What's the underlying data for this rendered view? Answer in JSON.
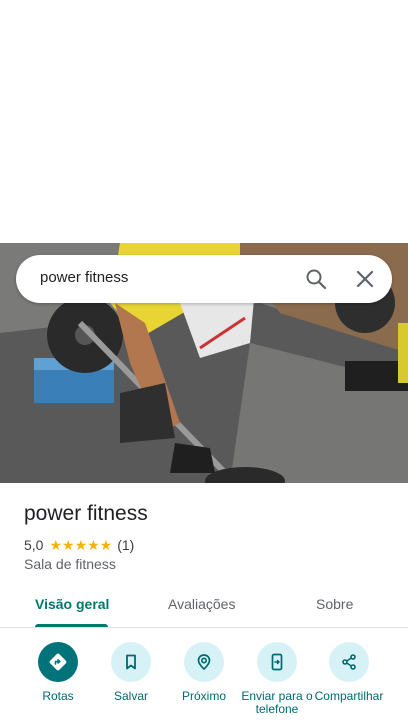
{
  "search": {
    "query": "power fitness"
  },
  "place": {
    "title": "power fitness",
    "rating": "5,0",
    "stars": "★★★★★",
    "review_count": "(1)",
    "category": "Sala de fitness"
  },
  "tabs": [
    {
      "label": "Visão geral",
      "active": true
    },
    {
      "label": "Avaliações",
      "active": false
    },
    {
      "label": "Sobre",
      "active": false
    }
  ],
  "actions": [
    {
      "label": "Rotas",
      "icon": "directions-icon"
    },
    {
      "label": "Salvar",
      "icon": "bookmark-icon"
    },
    {
      "label": "Próximo",
      "icon": "nearby-icon"
    },
    {
      "label": "Enviar para o telefone",
      "icon": "send-to-phone-icon"
    },
    {
      "label": "Compartilhar",
      "icon": "share-icon"
    }
  ],
  "colors": {
    "accent": "#00796b",
    "action_bg": "#d7f2f7",
    "primary_action": "#00737a",
    "star": "#f4b400"
  }
}
